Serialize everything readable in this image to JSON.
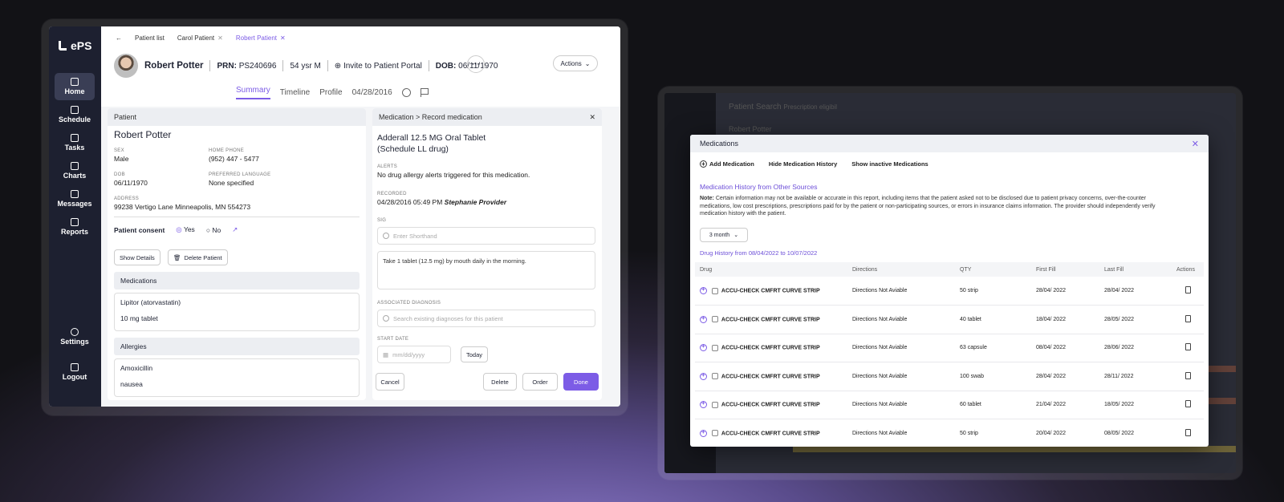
{
  "app": {
    "logo": "ePS"
  },
  "nav": [
    {
      "label": "Home"
    },
    {
      "label": "Schedule"
    },
    {
      "label": "Tasks"
    },
    {
      "label": "Charts"
    },
    {
      "label": "Messages"
    },
    {
      "label": "Reports"
    }
  ],
  "nav_bottom": [
    {
      "label": "Settings"
    },
    {
      "label": "Logout"
    }
  ],
  "breadcrumbs": {
    "items": [
      {
        "label": "Patient list"
      },
      {
        "label": "Carol Patient"
      },
      {
        "label": "Robert Patient"
      }
    ]
  },
  "patient": {
    "name": "Robert Potter",
    "prn_label": "PRN:",
    "prn": "PS240696",
    "age_sex": "54 ysr M",
    "invite": "Invite to Patient Portal",
    "dob_label": "DOB:",
    "dob": "06/11/1970",
    "actions": "Actions"
  },
  "tabs": {
    "summary": "Summary",
    "timeline": "Timeline",
    "profile": "Profile",
    "date": "04/28/2016"
  },
  "patient_card": {
    "header": "Patient",
    "name": "Robert Potter",
    "sex_label": "SEX",
    "sex": "Male",
    "phone_label": "HOME PHONE",
    "phone": "(952) 447 - 5477",
    "dob_label": "DOB",
    "dob": "06/11/1970",
    "lang_label": "PREFERRED LANGUAGE",
    "lang": "None specified",
    "addr_label": "ADDRESS",
    "addr": "99238 Vertigo Lane Minneapolis, MN 554273",
    "consent_label": "Patient consent",
    "yes": "Yes",
    "no": "No",
    "show_details": "Show Details",
    "delete_patient": "Delete Patient",
    "meds_header": "Medications",
    "med_name": "Lipitor (atorvastatin)",
    "med_dose": "10 mg tablet",
    "allergies_header": "Allergies",
    "allergy_name": "Amoxicillin",
    "allergy_reaction": "nausea"
  },
  "record": {
    "header": "Medication > Record medication",
    "drug_line1": "Adderall 12.5 MG Oral Tablet",
    "drug_line2": "(Schedule LL drug)",
    "alerts_label": "ALERTS",
    "alerts": "No drug allergy alerts triggered for this medication.",
    "recorded_label": "RECORDED",
    "recorded": "04/28/2016 05:49 PM",
    "provider": "Stephanie Provider",
    "sig_label": "SIG",
    "sig_placeholder": "Enter Shorthand",
    "sig_text": "Take 1 tablet (12.5 mg) by mouth daily in the morning.",
    "diag_label": "ASSOCIATED DIAGNOSIS",
    "diag_placeholder": "Search existing diagnoses for this patient",
    "start_label": "START DATE",
    "start_placeholder": "mm/dd/yyyy",
    "today": "Today",
    "cancel": "Cancel",
    "delete": "Delete",
    "order": "Order",
    "done": "Done"
  },
  "bg": {
    "title": "Patient Search",
    "sub": "Prescription eligibil",
    "name": "Robert Potter"
  },
  "modal": {
    "title": "Medications",
    "add": "Add Medication",
    "hide": "Hide Medication History",
    "show": "Show inactive Medications",
    "history_title": "Medication History from Other Sources",
    "note_bold": "Note:",
    "note": "Certain information may not be available or accurate in this report, including items that the patient asked not to be disclosed due to patient privacy concerns, over-the-counter medications, low cost prescriptions, prescriptions paid for by the patient or non-participating sources, or errors in insurance claims information. The provider should independently verify medication history with the patient.",
    "period": "3 month",
    "range": "Drug History from 08/04/2022 to 10/07/2022",
    "columns": [
      "Drug",
      "Directions",
      "QTY",
      "First Fill",
      "Last Fill",
      "Actions"
    ],
    "rows": [
      {
        "drug": "ACCU-CHECK CMFRT CURVE STRIP",
        "dir": "Directions Not Aviable",
        "qty": "50 strip",
        "first": "28/04/ 2022",
        "last": "28/04/ 2022"
      },
      {
        "drug": "ACCU-CHECK CMFRT CURVE STRIP",
        "dir": "Directions Not Aviable",
        "qty": "40 tablet",
        "first": "18/04/ 2022",
        "last": "28/05/ 2022"
      },
      {
        "drug": "ACCU-CHECK CMFRT CURVE STRIP",
        "dir": "Directions Not Aviable",
        "qty": "63 capsule",
        "first": "08/04/ 2022",
        "last": "28/06/ 2022"
      },
      {
        "drug": "ACCU-CHECK CMFRT CURVE STRIP",
        "dir": "Directions Not Aviable",
        "qty": "100 swab",
        "first": "28/04/ 2022",
        "last": "28/11/ 2022"
      },
      {
        "drug": "ACCU-CHECK CMFRT CURVE STRIP",
        "dir": "Directions Not Aviable",
        "qty": "60 tablet",
        "first": "21/04/ 2022",
        "last": "18/05/ 2022"
      },
      {
        "drug": "ACCU-CHECK CMFRT CURVE STRIP",
        "dir": "Directions Not Aviable",
        "qty": "50 strip",
        "first": "20/04/ 2022",
        "last": "08/05/ 2022"
      }
    ]
  },
  "colors": {
    "accent": "#7c5ce6",
    "sidebar": "#1d2030"
  }
}
